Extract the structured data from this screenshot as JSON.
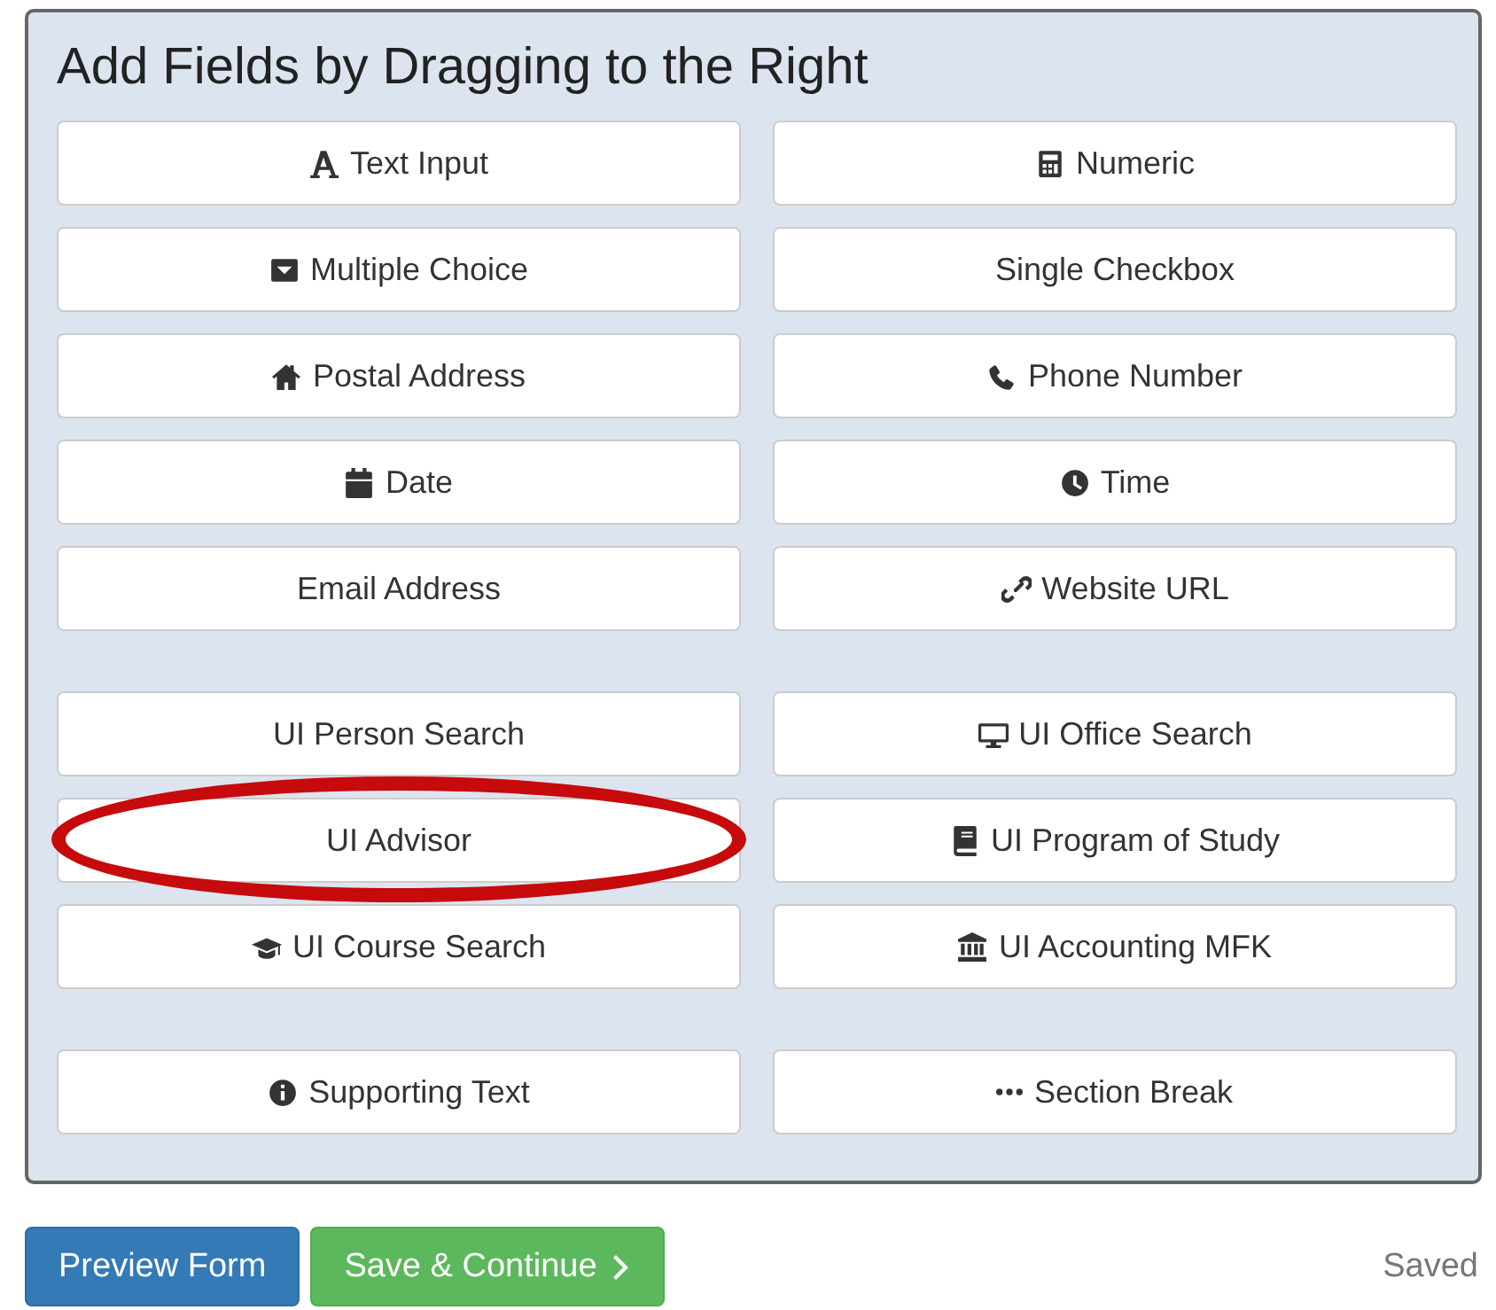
{
  "panel": {
    "title": "Add Fields by Dragging to the Right"
  },
  "groups": [
    {
      "fields": [
        {
          "label": "Text Input",
          "circled": false
        },
        {
          "label": "Numeric",
          "circled": false
        },
        {
          "label": "Multiple Choice",
          "circled": false
        },
        {
          "label": "Single Checkbox",
          "circled": false
        },
        {
          "label": "Postal Address",
          "circled": false
        },
        {
          "label": "Phone Number",
          "circled": false
        },
        {
          "label": "Date",
          "circled": false
        },
        {
          "label": "Time",
          "circled": false
        },
        {
          "label": "Email Address",
          "circled": false
        },
        {
          "label": "Website URL",
          "circled": false
        }
      ]
    },
    {
      "fields": [
        {
          "label": "UI Person Search",
          "circled": false
        },
        {
          "label": "UI Office Search",
          "circled": false
        },
        {
          "label": "UI Advisor",
          "circled": true
        },
        {
          "label": "UI Program of Study",
          "circled": false
        },
        {
          "label": "UI Course Search",
          "circled": false
        },
        {
          "label": "UI Accounting MFK",
          "circled": false
        }
      ]
    },
    {
      "fields": [
        {
          "label": "Supporting Text",
          "circled": false
        },
        {
          "label": "Section Break",
          "circled": false
        }
      ]
    }
  ],
  "actions": [
    {
      "label": "Preview Form",
      "kind": "primary"
    },
    {
      "label": "Save & Continue",
      "kind": "success"
    }
  ],
  "status": "Saved"
}
